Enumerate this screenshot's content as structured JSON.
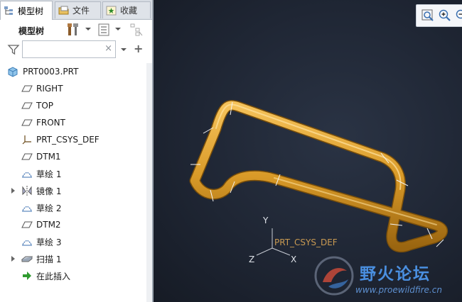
{
  "tabs": [
    {
      "label": "模型树",
      "active": true
    },
    {
      "label": "文件",
      "active": false
    },
    {
      "label": "收藏",
      "active": false
    }
  ],
  "toolbar": {
    "title": "模型树"
  },
  "filter": {
    "value": "",
    "placeholder": "",
    "clear_glyph": "×",
    "add_glyph": "+"
  },
  "tree": {
    "root": "PRT0003.PRT",
    "items": [
      {
        "label": "RIGHT",
        "icon": "datum-plane-icon",
        "expandable": false
      },
      {
        "label": "TOP",
        "icon": "datum-plane-icon",
        "expandable": false
      },
      {
        "label": "FRONT",
        "icon": "datum-plane-icon",
        "expandable": false
      },
      {
        "label": "PRT_CSYS_DEF",
        "icon": "csys-icon",
        "expandable": false
      },
      {
        "label": "DTM1",
        "icon": "datum-plane-icon",
        "expandable": false
      },
      {
        "label": "草绘 1",
        "icon": "sketch-icon",
        "expandable": false
      },
      {
        "label": "镜像 1",
        "icon": "mirror-icon",
        "expandable": true
      },
      {
        "label": "草绘 2",
        "icon": "sketch-icon",
        "expandable": false
      },
      {
        "label": "DTM2",
        "icon": "datum-plane-icon",
        "expandable": false
      },
      {
        "label": "草绘 3",
        "icon": "sketch-icon",
        "expandable": false
      },
      {
        "label": "扫描 1",
        "icon": "sweep-icon",
        "expandable": true
      },
      {
        "label": "在此插入",
        "icon": "insert-here-icon",
        "expandable": false
      }
    ]
  },
  "viewport": {
    "csys_label": "PRT_CSYS_DEF",
    "axis_y": "Y",
    "axis_x": "X",
    "axis_z": "Z",
    "model_color": "#e0a030",
    "background": "#1f2634"
  },
  "watermark": {
    "title": "野火论坛",
    "url": "www.proewildfire.cn"
  }
}
